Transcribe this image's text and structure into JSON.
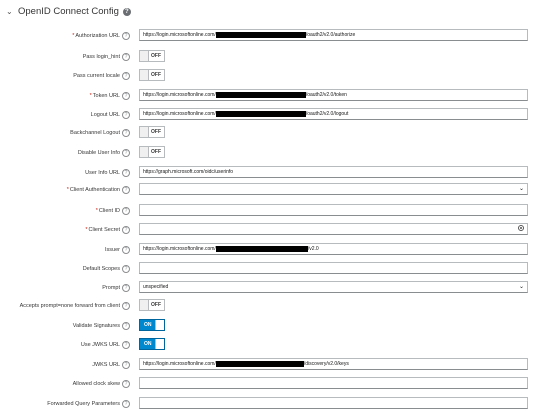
{
  "section": {
    "title": "OpenID Connect Config"
  },
  "fields": {
    "authorization_url": {
      "label": "Authorization URL",
      "prefix": "https://login.microsoftonline.com/",
      "suffix": "/oauth2/v2.0/authorize"
    },
    "pass_login_hint": {
      "label": "Pass login_hint",
      "state": "OFF"
    },
    "pass_current_locale": {
      "label": "Pass current locale",
      "state": "OFF"
    },
    "token_url": {
      "label": "Token URL",
      "prefix": "https://login.microsoftonline.com/",
      "suffix": "/oauth2/v2.0/token"
    },
    "logout_url": {
      "label": "Logout URL",
      "prefix": "https://login.microsoftonline.com/",
      "suffix": "/oauth2/v2.0/logout"
    },
    "backchannel_logout": {
      "label": "Backchannel Logout",
      "state": "OFF"
    },
    "disable_user_info": {
      "label": "Disable User Info",
      "state": "OFF"
    },
    "user_info_url": {
      "label": "User Info URL",
      "value": "https://graph.microsoft.com/oidc/userinfo"
    },
    "client_authentication": {
      "label": "Client Authentication",
      "value": ""
    },
    "client_id": {
      "label": "Client ID",
      "value": ""
    },
    "client_secret": {
      "label": "Client Secret",
      "value": ""
    },
    "issuer": {
      "label": "Issuer",
      "prefix": "https://login.microsoftonline.com/",
      "suffix": "/v2.0"
    },
    "default_scopes": {
      "label": "Default Scopes",
      "value": ""
    },
    "prompt": {
      "label": "Prompt",
      "value": "unspecified"
    },
    "accepts_prompt_none": {
      "label": "Accepts prompt=none forward from client",
      "state": "OFF"
    },
    "validate_signatures": {
      "label": "Validate Signatures",
      "state": "ON"
    },
    "use_jwks_url": {
      "label": "Use JWKS URL",
      "state": "ON"
    },
    "jwks_url": {
      "label": "JWKS URL",
      "prefix": "https://login.microsoftonline.com/",
      "suffix": "/discovery/v2.0/keys"
    },
    "allowed_clock_skew": {
      "label": "Allowed clock skew",
      "value": ""
    },
    "forwarded_query_parameters": {
      "label": "Forwarded Query Parameters",
      "value": ""
    }
  },
  "colors": {
    "toggle_on": "#0088ce",
    "required": "#c9190b"
  }
}
